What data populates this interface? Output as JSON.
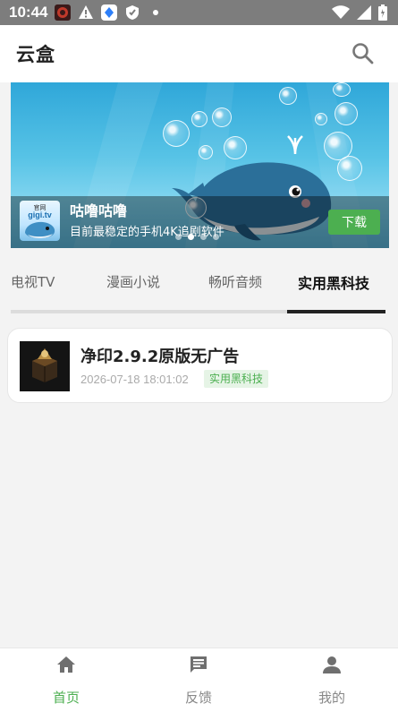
{
  "status_bar": {
    "time": "10:44"
  },
  "header": {
    "title": "云盒"
  },
  "banner": {
    "logo_small": "官网",
    "logo_site": "gigi.tv",
    "title": "咕噜咕噜",
    "subtitle": "目前最稳定的手机4K追剧软件",
    "download_label": "下载",
    "dot_count": 4,
    "active_dot": 1
  },
  "tabs": [
    {
      "label": "电视TV"
    },
    {
      "label": "漫画小说"
    },
    {
      "label": "畅听音频"
    },
    {
      "label": "实用黑科技"
    }
  ],
  "active_tab": 3,
  "list": [
    {
      "title": "净印2.9.2原版无广告",
      "date": "2026-07-18 18:01:02",
      "tag": "实用黑科技"
    }
  ],
  "bottom_nav": [
    {
      "label": "首页",
      "icon": "home-icon"
    },
    {
      "label": "反馈",
      "icon": "message-icon"
    },
    {
      "label": "我的",
      "icon": "person-icon"
    }
  ],
  "active_nav": 0,
  "colors": {
    "accent": "#4caf50",
    "status_bar": "#7d7d7d"
  }
}
